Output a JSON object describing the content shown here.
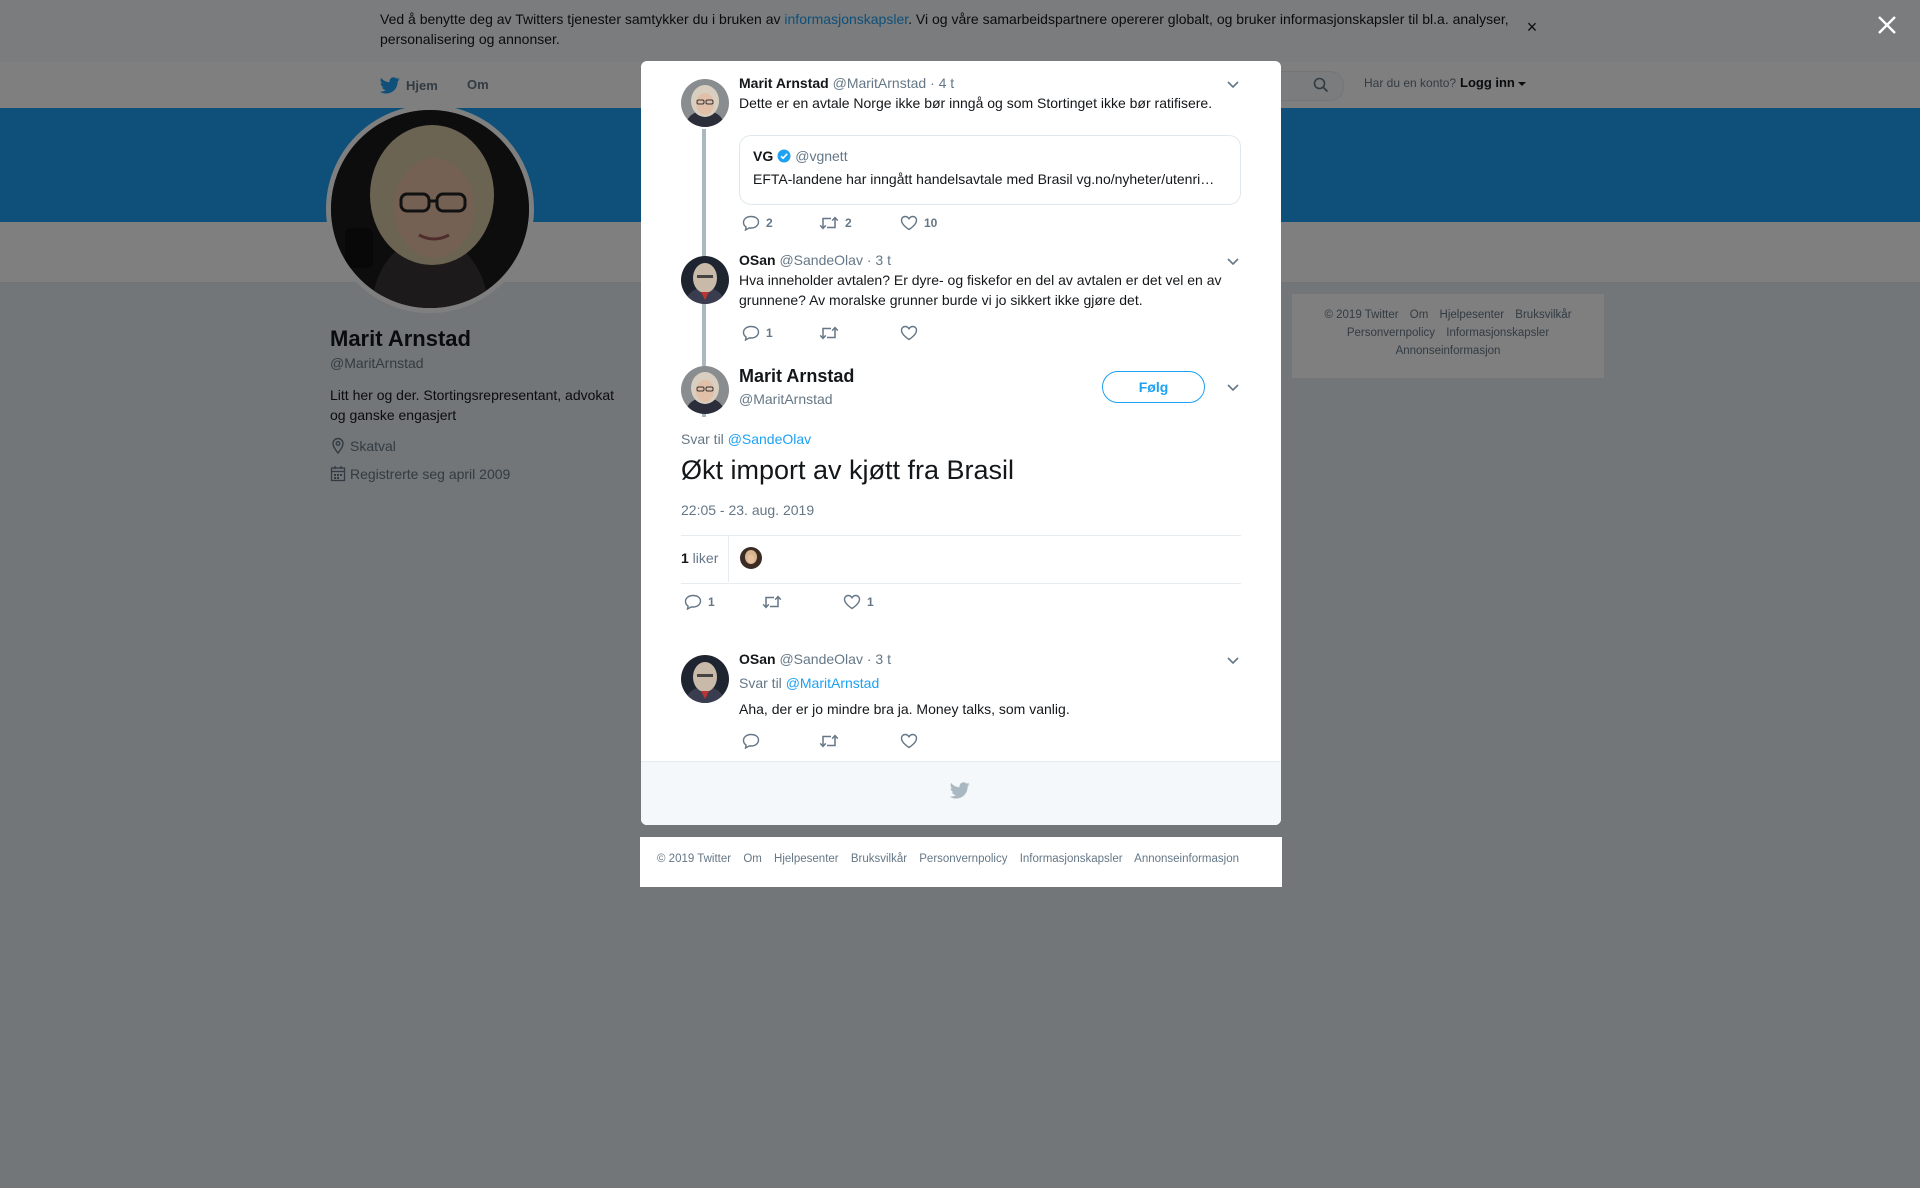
{
  "cookie_notice": {
    "text_before": "Ved å benytte deg av Twitters tjenester samtykker du i bruken av ",
    "link": "informasjonskapsler",
    "text_after": ". Vi og våre samarbeidspartnere opererer globalt, og bruker informasjonskapsler til bl.a. analyser, personalisering og annonser.",
    "close": "×"
  },
  "topnav": {
    "home": "Hjem",
    "about": "Om",
    "account_question": "Har du en konto?",
    "login": "Logg inn"
  },
  "profile": {
    "name": "Marit Arnstad",
    "handle": "@MaritArnstad",
    "bio": "Litt her og der. Stortingsrepresentant, advokat og ganske engasjert",
    "location": "Skatval",
    "joined": "Registrerte seg april 2009"
  },
  "side_footer": {
    "items": [
      "© 2019 Twitter",
      "Om",
      "Hjelpesenter",
      "Bruksvilkår",
      "Personvernpolicy",
      "Informasjonskapsler",
      "Annonseinformasjon"
    ]
  },
  "thread": {
    "tweet1": {
      "name": "Marit Arnstad",
      "handle": "@MaritArnstad",
      "time": "· 4 t",
      "text": "Dette er en avtale Norge ikke bør inngå og som Stortinget ikke bør ratifisere.",
      "quote": {
        "name": "VG",
        "handle": "@vgnett",
        "text": "EFTA-landene har inngått handelsavtale med Brasil vg.no/nyheter/utenri…"
      },
      "replies": "2",
      "retweets": "2",
      "likes": "10"
    },
    "tweet2": {
      "name": "OSan",
      "handle": "@SandeOlav",
      "time": "· 3 t",
      "text": "Hva inneholder avtalen? Er dyre- og fiskefor en del av avtalen er det vel en av grunnene? Av moralske grunner burde vi jo sikkert ikke gjøre det.",
      "replies": "1"
    },
    "main": {
      "name": "Marit Arnstad",
      "handle": "@MaritArnstad",
      "follow": "Følg",
      "reply_prefix": "Svar til ",
      "reply_to": "@SandeOlav",
      "text": "Økt import av kjøtt fra Brasil",
      "timestamp": "22:05 - 23. aug. 2019",
      "likes_count": "1",
      "likes_label": " liker",
      "replies": "1",
      "likes": "1"
    },
    "reply": {
      "name": "OSan",
      "handle": "@SandeOlav",
      "time": "· 3 t",
      "reply_prefix": "Svar til ",
      "reply_to": "@MaritArnstad",
      "text": "Aha, der er jo mindre bra ja. Money talks, som vanlig."
    }
  },
  "bottom_footer": {
    "items": [
      "© 2019 Twitter",
      "Om",
      "Hjelpesenter",
      "Bruksvilkår",
      "Personvernpolicy",
      "Informasjonskapsler",
      "Annonseinformasjon"
    ]
  },
  "colors": {
    "accent": "#1da1f2",
    "text": "#14171a",
    "secondary_text": "#657786",
    "overlay": "rgba(0,0,0,0.5)"
  },
  "icons": [
    "twitter-bird-icon",
    "search-icon",
    "location-pin-icon",
    "calendar-icon",
    "close-icon",
    "chevron-down-icon",
    "reply-icon",
    "retweet-icon",
    "like-icon",
    "verified-badge-icon"
  ]
}
